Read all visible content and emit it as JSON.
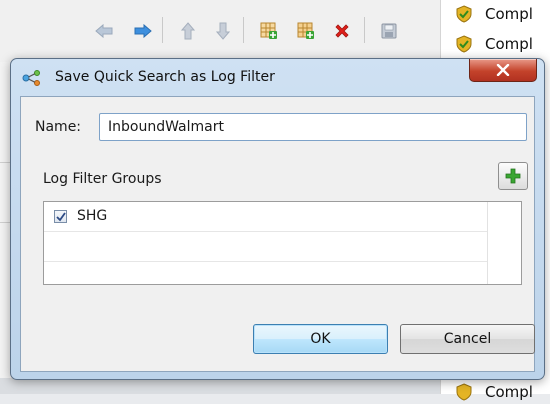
{
  "background": {
    "toolbar_icons": [
      "arrow-left-icon",
      "arrow-right-icon",
      "arrow-up-icon",
      "arrow-down-icon",
      "table-add-icon",
      "table-add-green-icon",
      "delete-icon",
      "save-icon"
    ],
    "status_rows": [
      "Compl",
      "Compl",
      "Compl"
    ]
  },
  "dialog": {
    "title": "Save Quick Search as Log Filter",
    "name_label": "Name:",
    "name_value": "InboundWalmart",
    "groups_label": "Log Filter Groups",
    "groups": [
      {
        "label": "SHG",
        "checked": true
      }
    ],
    "ok_label": "OK",
    "cancel_label": "Cancel",
    "close_label": "X"
  },
  "colors": {
    "title_gradient": "#cfe1f3",
    "close_red": "#c4432b",
    "ok_blue": "#3c7fb1",
    "add_green": "#3aa632"
  }
}
